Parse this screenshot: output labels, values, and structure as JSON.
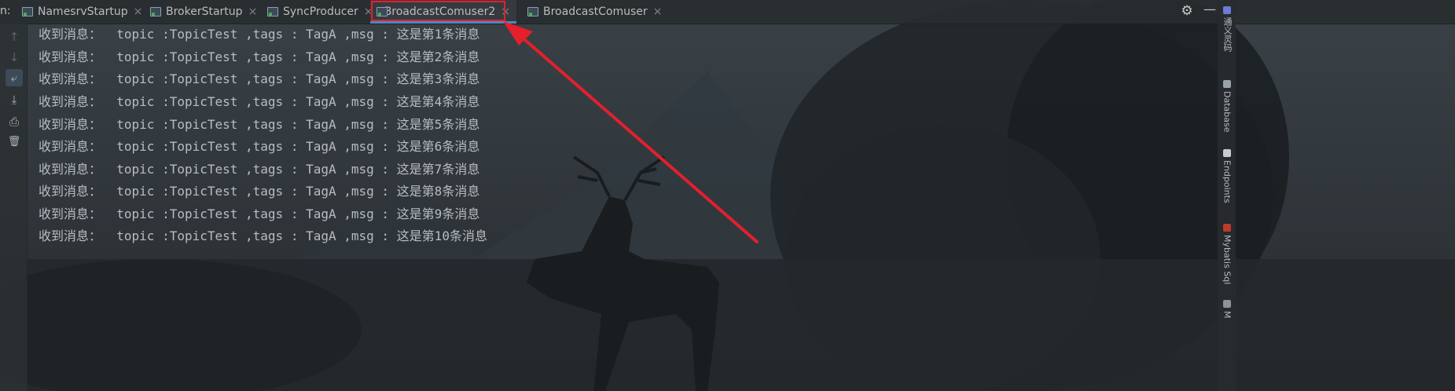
{
  "run_label": "n:",
  "tabs": [
    {
      "label": "NamesrvStartup",
      "active": false
    },
    {
      "label": "BrokerStartup",
      "active": false
    },
    {
      "label": "SyncProducer",
      "active": false
    },
    {
      "label": "BroadcastComuser2",
      "active": true
    },
    {
      "label": "BroadcastComuser",
      "active": false
    }
  ],
  "window_controls": {
    "settings_icon": "gear-icon",
    "minimize_icon": "minimize-icon"
  },
  "toolbar": [
    {
      "icon": "arrow-up-icon",
      "glyph": "↑"
    },
    {
      "icon": "arrow-down-icon",
      "glyph": "↓"
    },
    {
      "icon": "soft-wrap-icon",
      "glyph": "⤶"
    },
    {
      "icon": "scroll-to-end-icon",
      "glyph": "⤓"
    },
    {
      "icon": "print-icon",
      "glyph": "⎙"
    },
    {
      "icon": "trash-icon",
      "glyph": "🗑"
    }
  ],
  "console_lines": [
    "收到消息：  topic :TopicTest ,tags : TagA ,msg : 这是第1条消息",
    "收到消息：  topic :TopicTest ,tags : TagA ,msg : 这是第2条消息",
    "收到消息：  topic :TopicTest ,tags : TagA ,msg : 这是第3条消息",
    "收到消息：  topic :TopicTest ,tags : TagA ,msg : 这是第4条消息",
    "收到消息：  topic :TopicTest ,tags : TagA ,msg : 这是第5条消息",
    "收到消息：  topic :TopicTest ,tags : TagA ,msg : 这是第6条消息",
    "收到消息：  topic :TopicTest ,tags : TagA ,msg : 这是第7条消息",
    "收到消息：  topic :TopicTest ,tags : TagA ,msg : 这是第8条消息",
    "收到消息：  topic :TopicTest ,tags : TagA ,msg : 这是第9条消息",
    "收到消息：  topic :TopicTest ,tags : TagA ,msg : 这是第10条消息"
  ],
  "right_panels": [
    {
      "label": "通义灵码",
      "icon": "ai-assistant-icon"
    },
    {
      "label": "Database",
      "icon": "database-icon"
    },
    {
      "label": "Endpoints",
      "icon": "endpoints-icon"
    },
    {
      "label": "Mybatis Sql",
      "icon": "mybatis-icon"
    },
    {
      "label": "M",
      "icon": "maven-icon"
    }
  ],
  "colors": {
    "highlight_box": "#e3202c",
    "active_tab_underline": "#4a88c7",
    "arrow": "#e3202c"
  }
}
